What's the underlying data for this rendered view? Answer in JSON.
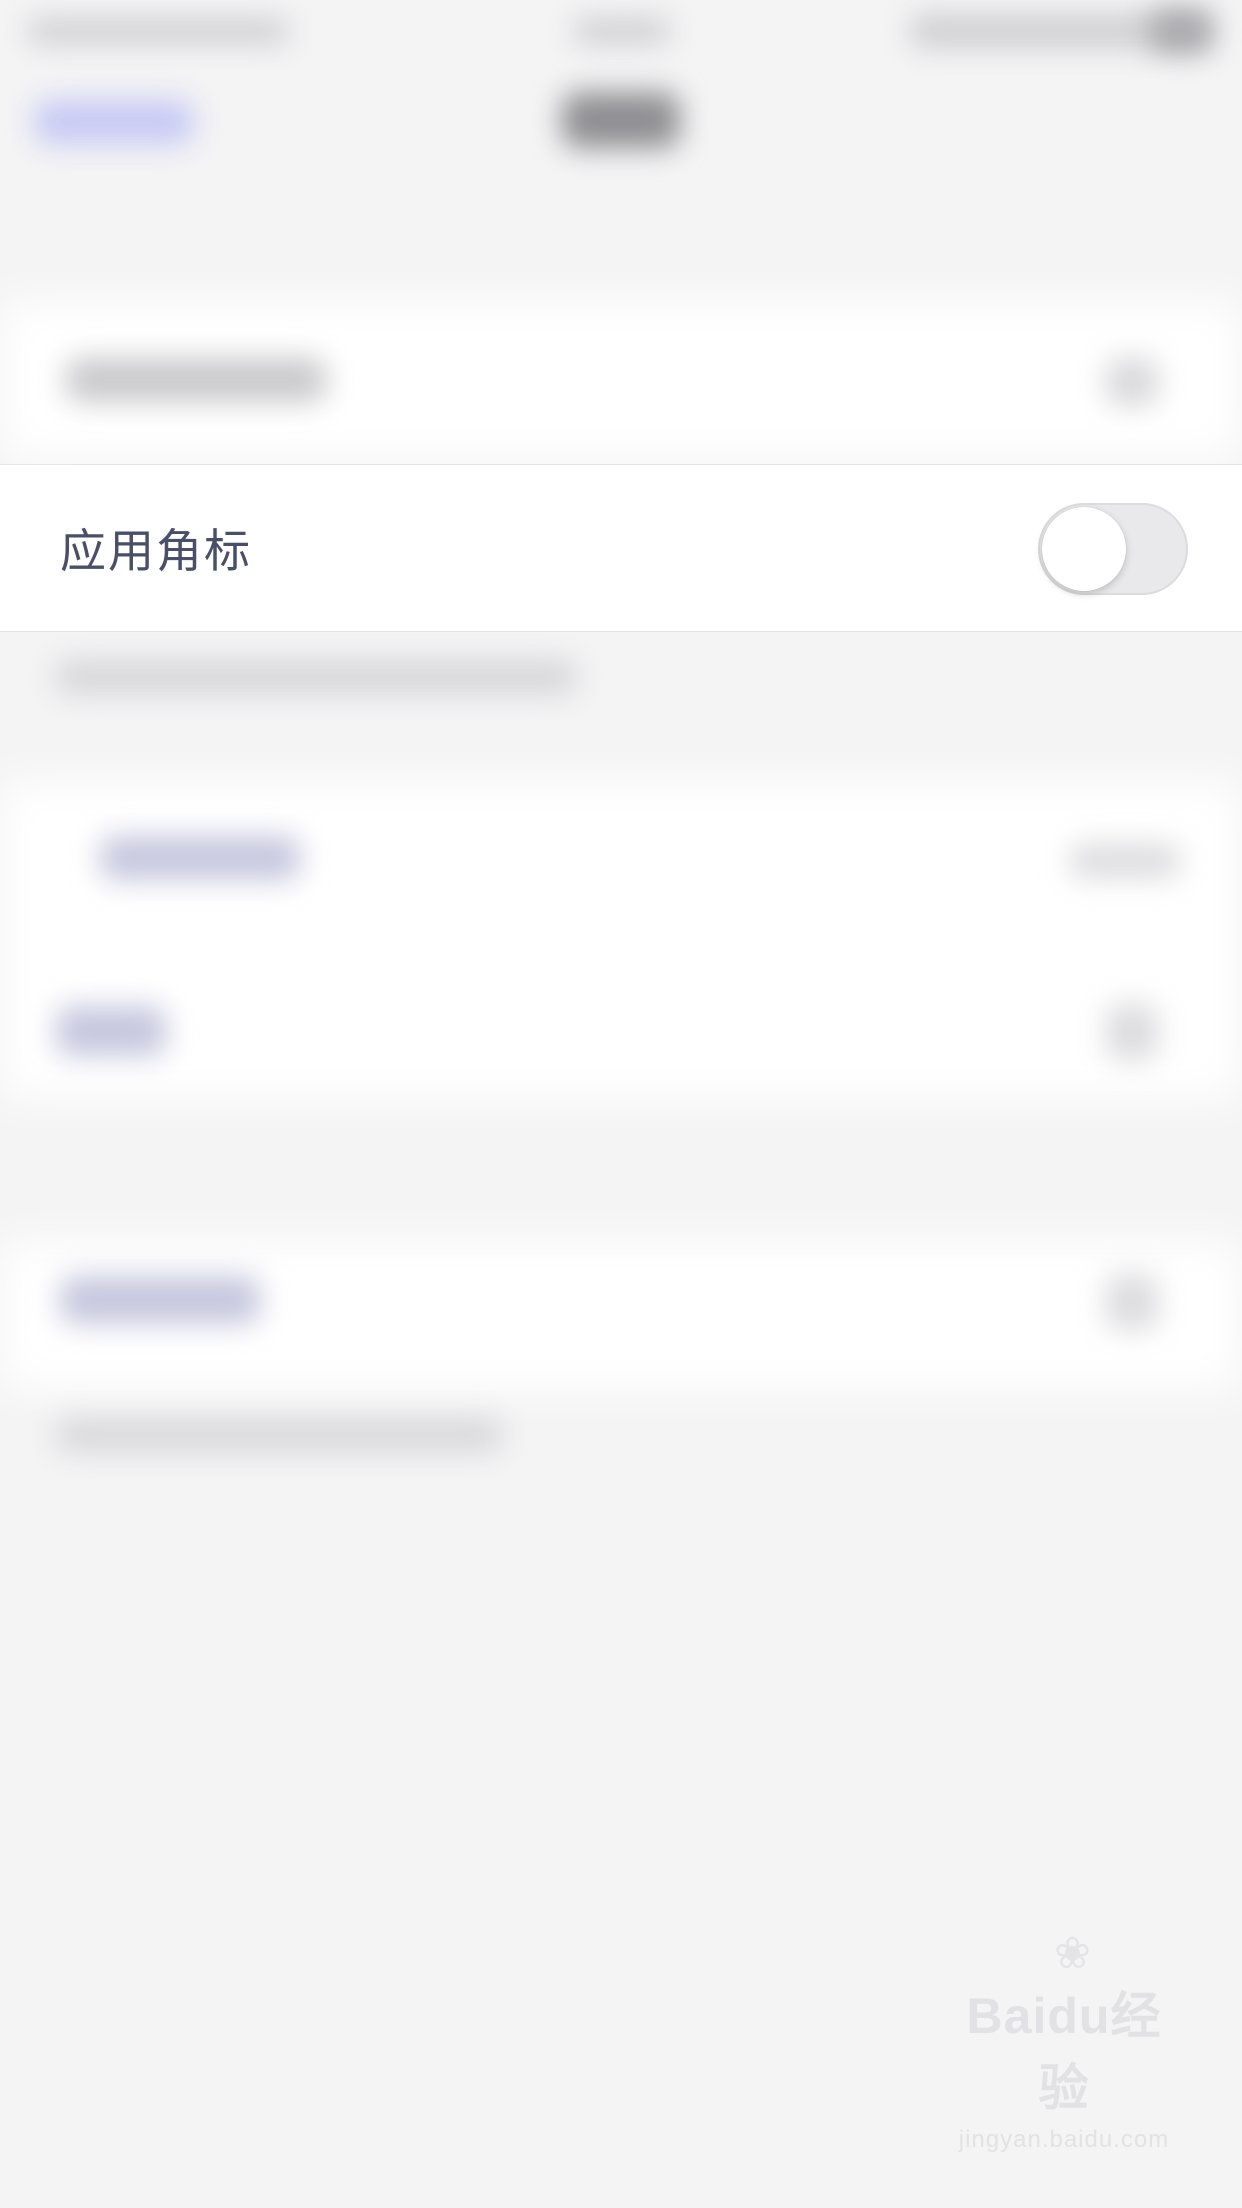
{
  "settings": {
    "badge_row_label": "应用角标",
    "badge_toggle": {
      "enabled": false,
      "state_label": "off"
    }
  },
  "watermark": {
    "brand": "Bai",
    "brand_du": "du",
    "product": "经验",
    "url": "jingyan.baidu.com",
    "paw_icon": "paw-icon"
  },
  "colors": {
    "label_text": "#4a4f68",
    "toggle_off": "#e9e9eb",
    "row_background": "#ffffff",
    "page_background": "#f4f4f5"
  }
}
